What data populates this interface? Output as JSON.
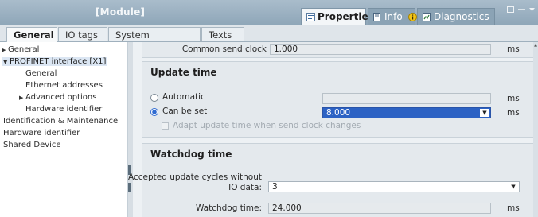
{
  "inspector": {
    "module_title": "[Module]",
    "tabs": [
      {
        "label": "Properties",
        "icon": "properties-icon"
      },
      {
        "label": "Info",
        "icon": "info-icon"
      },
      {
        "label": "Diagnostics",
        "icon": "diagnostics-icon"
      }
    ],
    "active_tab": "Properties"
  },
  "subtabs": [
    {
      "label": "General"
    },
    {
      "label": "IO tags"
    },
    {
      "label": "System constants"
    },
    {
      "label": "Texts"
    }
  ],
  "nav": {
    "items": [
      {
        "label": "General"
      },
      {
        "label": "PROFINET interface [X1]"
      },
      {
        "label": "General"
      },
      {
        "label": "Ethernet addresses"
      },
      {
        "label": "Advanced options"
      },
      {
        "label": "Hardware identifier"
      },
      {
        "label": "Identification & Maintenance"
      },
      {
        "label": "Hardware identifier"
      },
      {
        "label": "Shared Device"
      }
    ],
    "selected": "PROFINET interface [X1]"
  },
  "common_send_clock": {
    "label": "Common send clock",
    "value": "1.000",
    "unit": "ms"
  },
  "update_time": {
    "title": "Update time",
    "automatic_label": "Automatic",
    "automatic_value": "",
    "automatic_unit": "ms",
    "can_be_set_label": "Can be set",
    "can_be_set_value": "8.000",
    "can_be_set_unit": "ms",
    "selected_option": "Can be set",
    "adapt_label": "Adapt update time when send clock changes",
    "adapt_checked": false
  },
  "watchdog": {
    "title": "Watchdog time",
    "cycles_label_line1": "Accepted update cycles without",
    "cycles_label_line2": "IO data:",
    "cycles_value": "3",
    "time_label": "Watchdog time:",
    "time_value": "24.000",
    "time_unit": "ms"
  },
  "colors": {
    "titlebar": "#8ea6b8",
    "selection": "#2c62c4",
    "accent_radio": "#2f6bd1"
  }
}
